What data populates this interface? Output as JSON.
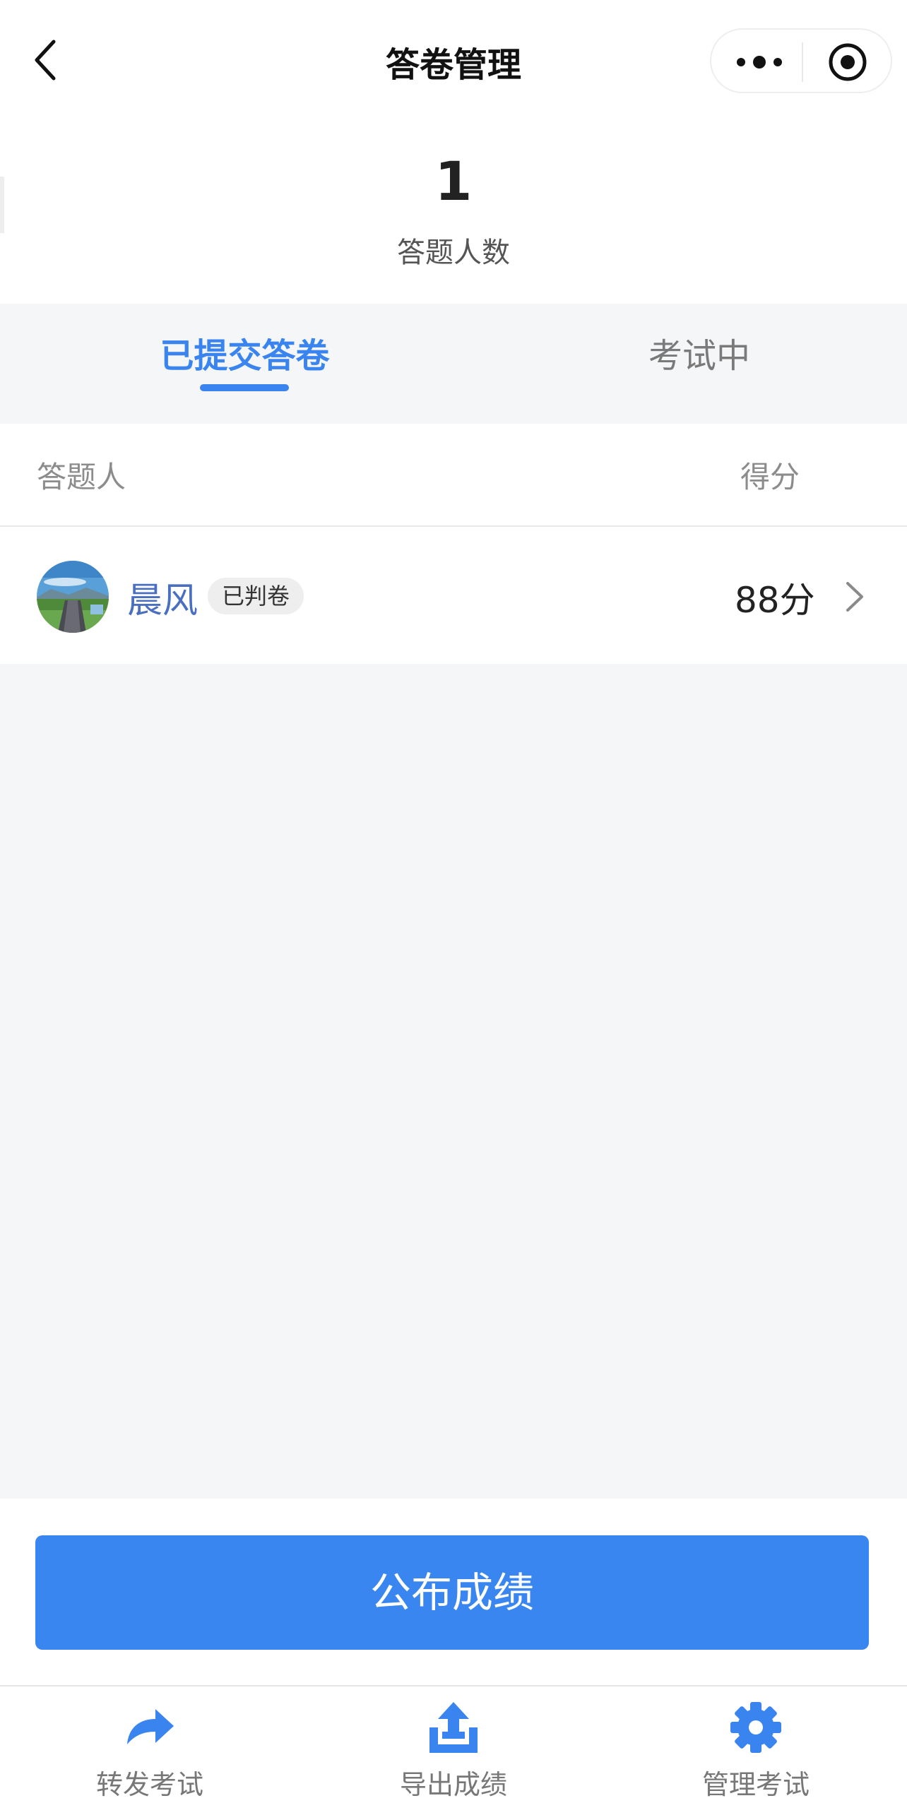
{
  "navbar": {
    "title": "答卷管理",
    "back_icon": "chevron-left-icon",
    "more_icon": "more-dots-icon",
    "close_icon": "target-circle-icon"
  },
  "summary": {
    "count": "1",
    "label": "答题人数"
  },
  "tabs": [
    {
      "label": "已提交答卷",
      "active": true
    },
    {
      "label": "考试中",
      "active": false
    }
  ],
  "table": {
    "headers": {
      "name": "答题人",
      "score": "得分"
    },
    "rows": [
      {
        "name": "晨风",
        "badge": "已判卷",
        "score": "88分"
      }
    ]
  },
  "publish_button": "公布成绩",
  "tabbar": [
    {
      "label": "转发考试",
      "icon": "share-arrow-icon"
    },
    {
      "label": "导出成绩",
      "icon": "export-upload-icon"
    },
    {
      "label": "管理考试",
      "icon": "gear-icon"
    }
  ],
  "colors": {
    "accent": "#3a84ef",
    "background": "#f5f6f8",
    "name_link": "#4a6fc0"
  }
}
